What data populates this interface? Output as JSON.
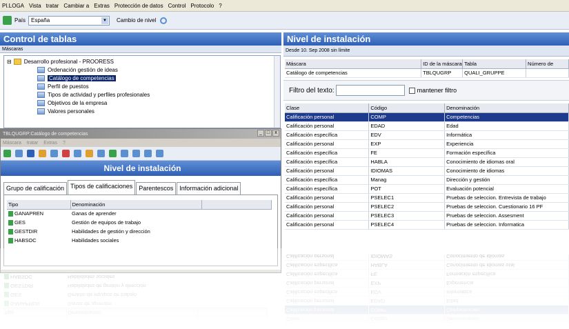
{
  "menubar": [
    "PI.LOGA",
    "Vista",
    "tratar",
    "Cambiar a",
    "Extras",
    "Protección de datos",
    "Control",
    "Protocolo",
    "?"
  ],
  "toolbar": {
    "pais_label": "País",
    "pais_value": "España",
    "nivel_label": "Cambio de nivel"
  },
  "left": {
    "title": "Control de tablas",
    "subbar": "Máscaras",
    "tree": [
      {
        "label": "Desarrollo profesional - PROORESS",
        "type": "folder"
      },
      {
        "label": "Ordenación gestión de ideas",
        "type": "item"
      },
      {
        "label": "Catálogo de competencias",
        "type": "item",
        "selected": true
      },
      {
        "label": "Perfil de puestos",
        "type": "item"
      },
      {
        "label": "Tipos de actividad y perfiles profesionales",
        "type": "item"
      },
      {
        "label": "Objetivos de la empresa",
        "type": "item"
      },
      {
        "label": "Valores personales",
        "type": "item"
      }
    ]
  },
  "mdi": {
    "title": "TBLQUGRP:Catálogo de competencias",
    "menu": [
      "Máscara",
      "tratar",
      "Extras",
      "?"
    ],
    "header": "Nivel de instalación",
    "tabs": [
      "Grupo de calificación",
      "Tipos de calificaciones",
      "Parentescos",
      "Información adicional"
    ],
    "active_tab": 1,
    "columns": [
      "Tipo",
      "Denominación"
    ],
    "rows": [
      [
        "GANAPREN",
        "Ganas de aprender"
      ],
      [
        "GES",
        "Gestión de equipos de trabajo"
      ],
      [
        "GESTDIR",
        "Habilidades de gestión y dirección"
      ],
      [
        "HABSOC",
        "Habilidades sociales"
      ]
    ]
  },
  "right": {
    "title": "Nivel de instalación",
    "subbar": "Desde 10. Sep 2008 sin límite",
    "mask_columns": [
      "Máscara",
      "ID de la máscara",
      "Tabla",
      "Número de"
    ],
    "mask_row": [
      "Catálogo de competencias",
      "TBLQUGRP",
      "QUALI_GRUPPE",
      ""
    ],
    "filter_label": "Filtro del texto:",
    "filter_value": "",
    "keep_filter": "mantener filtro",
    "columns": [
      "Clase",
      "Código",
      "Denominación"
    ],
    "rows": [
      [
        "Calificación personal",
        "COMP",
        "Competencias"
      ],
      [
        "Calificación personal",
        "EDAD",
        "Edad"
      ],
      [
        "Calificación específica",
        "EDV",
        "Informática"
      ],
      [
        "Calificación personal",
        "EXP",
        "Experiencia"
      ],
      [
        "Calificación específica",
        "FE",
        "Formación específica"
      ],
      [
        "Calificación específica",
        "HABLA",
        "Conocimiento de idiomas oral"
      ],
      [
        "Calificación personal",
        "IDIOMAS",
        "Conocimiento de idiomas"
      ],
      [
        "Calificación específica",
        "Manag",
        "Dirección y gestión"
      ],
      [
        "Calificación específica",
        "POT",
        "Evaluación potencial"
      ],
      [
        "Calificación personal",
        "PSELEC1",
        "Pruebas de seleccion. Entrevista de trabajo"
      ],
      [
        "Calificación personal",
        "PSELEC2",
        "Pruebas de seleccion. Cuestionario 16 PF"
      ],
      [
        "Calificación personal",
        "PSELEC3",
        "Pruebas de seleccion. Assesment"
      ],
      [
        "Calificación personal",
        "PSELEC4",
        "Pruebas de seleccion. Informatica"
      ]
    ],
    "selected_row": 0
  },
  "colors": {
    "title_blue": "#2f5fb5",
    "selection": "#1e3a8c"
  }
}
